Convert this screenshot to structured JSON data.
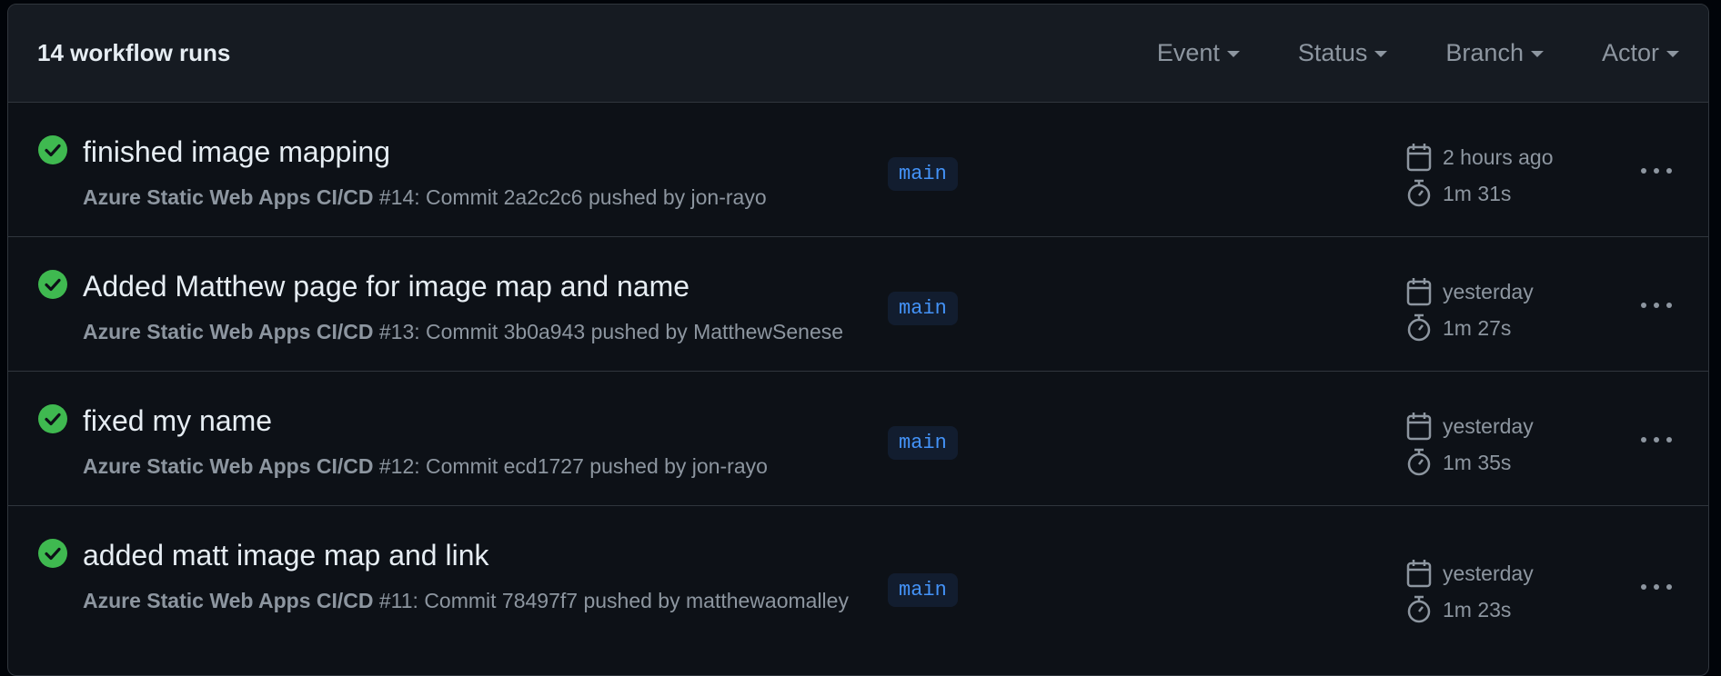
{
  "header": {
    "run_count": "14 workflow runs",
    "filters": [
      {
        "label": "Event"
      },
      {
        "label": "Status"
      },
      {
        "label": "Branch"
      },
      {
        "label": "Actor"
      }
    ]
  },
  "colors": {
    "success": "#3fb950",
    "branch_text": "#4493f8",
    "branch_bg": "#121d2f"
  },
  "runs": [
    {
      "title": "finished image mapping",
      "workflow": "Azure Static Web Apps CI/CD",
      "detail": "#14: Commit 2a2c2c6 pushed by jon-rayo",
      "branch": "main",
      "time": "2 hours ago",
      "duration": "1m 31s",
      "status_icon": "check-circle-fill-icon"
    },
    {
      "title": "Added Matthew page for image map and name",
      "workflow": "Azure Static Web Apps CI/CD",
      "detail": "#13: Commit 3b0a943 pushed by MatthewSenese",
      "branch": "main",
      "time": "yesterday",
      "duration": "1m 27s",
      "status_icon": "check-circle-fill-icon"
    },
    {
      "title": "fixed my name",
      "workflow": "Azure Static Web Apps CI/CD",
      "detail": "#12: Commit ecd1727 pushed by jon-rayo",
      "branch": "main",
      "time": "yesterday",
      "duration": "1m 35s",
      "status_icon": "check-circle-fill-icon"
    },
    {
      "title": "added matt image map and link",
      "workflow": "Azure Static Web Apps CI/CD",
      "detail": "#11: Commit 78497f7 pushed by matthewaomalley",
      "branch": "main",
      "time": "yesterday",
      "duration": "1m 23s",
      "status_icon": "check-circle-fill-icon"
    }
  ]
}
